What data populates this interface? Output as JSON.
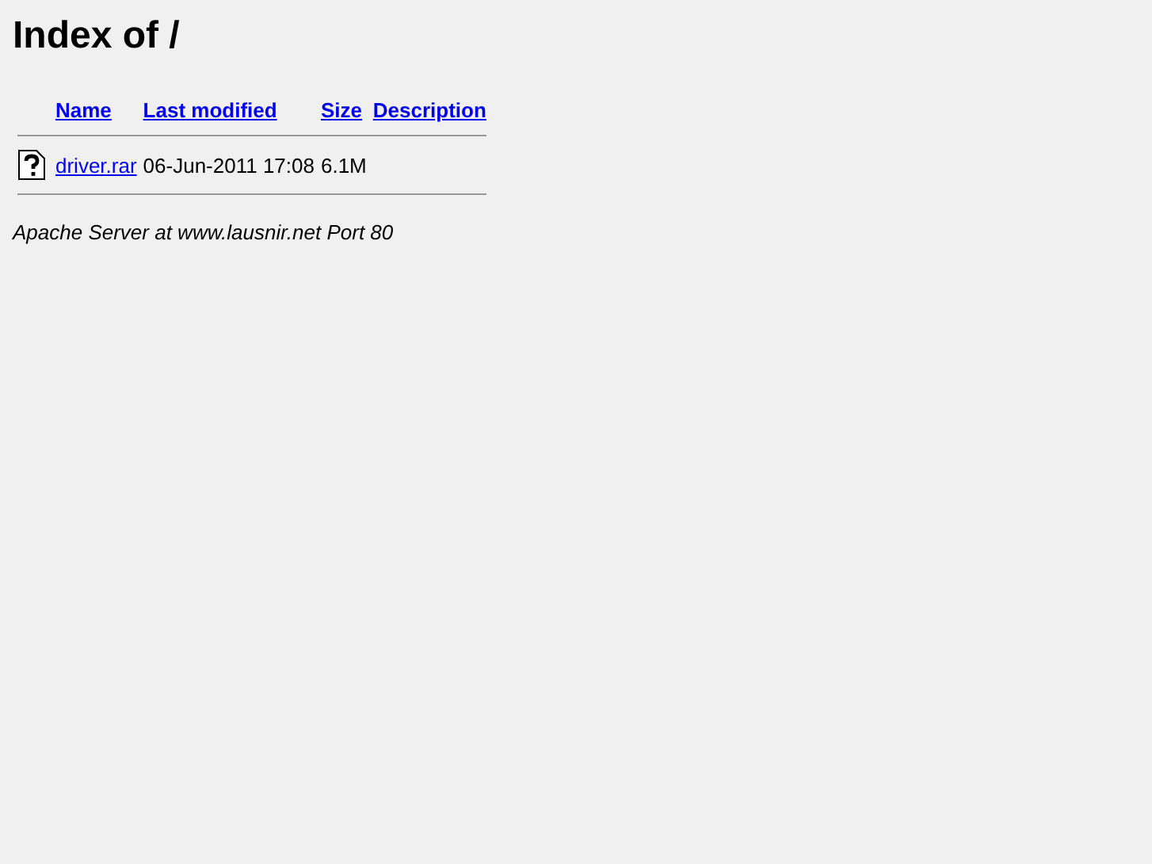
{
  "title": "Index of /",
  "columns": [
    "Name",
    "Last modified",
    "Size",
    "Description"
  ],
  "rows": [
    {
      "name": "driver.rar",
      "modified": "06-Jun-2011 17:08",
      "size": "6.1M"
    }
  ],
  "footer": "Apache Server at www.lausnir.net Port 80"
}
